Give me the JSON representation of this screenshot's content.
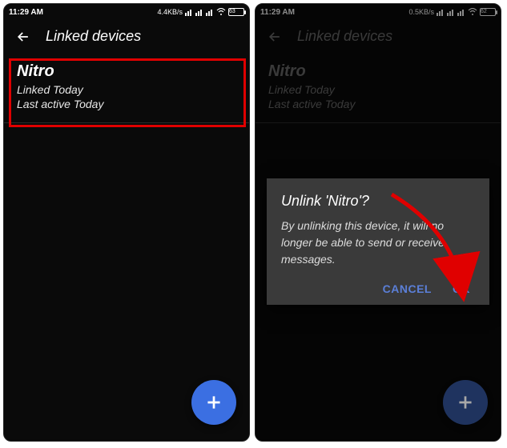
{
  "left": {
    "status": {
      "time": "11:29 AM",
      "speed": "4.4KB/s",
      "battery": "63"
    },
    "header": {
      "title": "Linked devices"
    },
    "device": {
      "name": "Nitro",
      "linked": "Linked Today",
      "active": "Last active Today"
    }
  },
  "right": {
    "status": {
      "time": "11:29 AM",
      "speed": "0.5KB/s",
      "battery": "62"
    },
    "header": {
      "title": "Linked devices"
    },
    "device": {
      "name": "Nitro",
      "linked": "Linked Today",
      "active": "Last active Today"
    },
    "dialog": {
      "title": "Unlink 'Nitro'?",
      "body": "By unlinking this device, it will no longer be able to send or receive messages.",
      "cancel": "CANCEL",
      "ok": "OK"
    }
  }
}
